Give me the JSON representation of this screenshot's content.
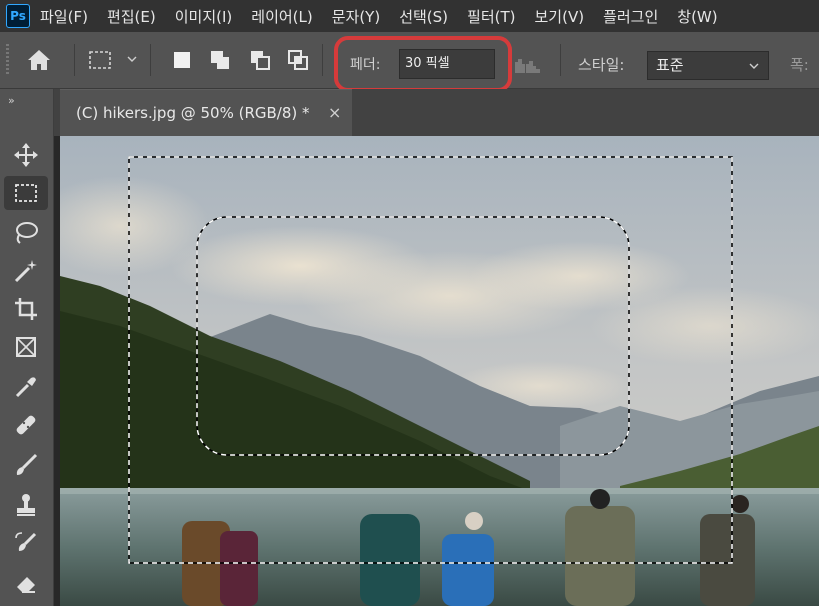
{
  "app": {
    "logo_text": "Ps"
  },
  "menu": [
    {
      "label": "파일(F)"
    },
    {
      "label": "편집(E)"
    },
    {
      "label": "이미지(I)"
    },
    {
      "label": "레이어(L)"
    },
    {
      "label": "문자(Y)"
    },
    {
      "label": "선택(S)"
    },
    {
      "label": "필터(T)"
    },
    {
      "label": "보기(V)"
    },
    {
      "label": "플러그인"
    },
    {
      "label": "창(W)"
    }
  ],
  "options": {
    "feather_label": "페더:",
    "feather_value": "30 픽셀",
    "style_label": "스타일:",
    "style_value": "표준",
    "width_label": "폭:"
  },
  "toolbar": {
    "collapse": "»"
  },
  "document": {
    "tab_title": "(C) hikers.jpg @ 50% (RGB/8) *",
    "close": "×"
  },
  "colors": {
    "highlight": "#d63b3b",
    "menubar_bg": "#323232",
    "panel_bg": "#535353"
  },
  "icons": [
    "home-icon",
    "rectangular-marquee-icon",
    "new-selection-icon",
    "add-selection-icon",
    "subtract-selection-icon",
    "intersect-selection-icon",
    "move-icon",
    "lasso-icon",
    "magic-wand-icon",
    "crop-icon",
    "frame-icon",
    "eyedropper-icon",
    "healing-brush-icon",
    "brush-icon",
    "clone-stamp-icon",
    "history-brush-icon",
    "eraser-icon"
  ]
}
